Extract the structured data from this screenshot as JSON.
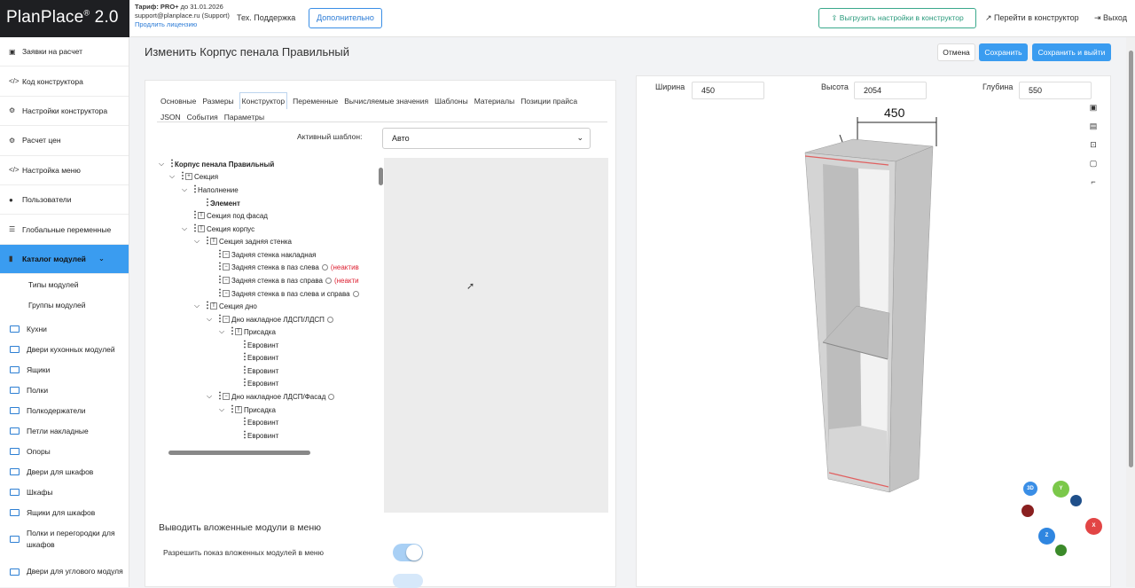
{
  "header": {
    "logo": "PlanPlace",
    "logo_sup": "®",
    "logo_suffix": " 2.0",
    "tariff_label": "Тариф: PRO+",
    "tariff_until": " до 31.01.2026",
    "email": "support@planplace.ru (Support)",
    "extend_license": "Продлить лицензию",
    "support": "Тех. Поддержка",
    "extra_button": "Дополнительно",
    "export_button": "Выгрузить настройки в конструктор",
    "go_constructor": "Перейти в конструктор",
    "logout": "Выход"
  },
  "sidebar": {
    "items": [
      {
        "label": "Заявки на расчет",
        "icon": "document-icon"
      },
      {
        "label": "Код конструктора",
        "icon": "code-icon"
      },
      {
        "label": "Настройки конструктора",
        "icon": "settings-icon"
      },
      {
        "label": "Расчет цен",
        "icon": "settings-icon"
      },
      {
        "label": "Настройка меню",
        "icon": "code-icon"
      },
      {
        "label": "Пользователи",
        "icon": "user-icon"
      },
      {
        "label": "Глобальные переменные",
        "icon": "list-icon"
      },
      {
        "label": "Каталог модулей",
        "icon": "book-icon"
      }
    ],
    "subitems": [
      "Типы модулей",
      "Группы модулей"
    ],
    "folders": [
      "Кухни",
      "Двери кухонных модулей",
      "Ящики",
      "Полки",
      "Полкодержатели",
      "Петли накладные",
      "Опоры",
      "Двери для шкафов",
      "Шкафы",
      "Ящики для шкафов",
      "Полки и перегородки для шкафов",
      "Двери для углового модуля"
    ]
  },
  "page": {
    "title": "Изменить Корпус пенала Правильный",
    "cancel": "Отмена",
    "save": "Сохранить",
    "save_exit": "Сохранить и выйти"
  },
  "tabs": [
    "Основные",
    "Размеры",
    "Конструктор",
    "Переменные",
    "Вычисляемые значения",
    "Шаблоны",
    "Материалы",
    "Позиции прайса",
    "JSON",
    "События",
    "Параметры"
  ],
  "active_tab": "Конструктор",
  "template": {
    "label": "Активный шаблон:",
    "value": "Авто"
  },
  "tree": [
    {
      "label": "Корпус пенала Правильный",
      "bold": true
    },
    {
      "label": "Секция"
    },
    {
      "label": "Наполнение"
    },
    {
      "label": "Элемент",
      "bold": true
    },
    {
      "label": "Секция под фасад"
    },
    {
      "label": "Секция корпус"
    },
    {
      "label": "Секция задняя стенка"
    },
    {
      "label": "Задняя стенка накладная"
    },
    {
      "label": "Задняя стенка в паз слева",
      "note": "(неактив"
    },
    {
      "label": "Задняя стенка в паз справа",
      "note": "(неакти"
    },
    {
      "label": "Задняя стенка в паз слева и справа"
    },
    {
      "label": "Секция дно"
    },
    {
      "label": "Дно накладное ЛДСП/ЛДСП"
    },
    {
      "label": "Присадка"
    },
    {
      "label": "Евровинт"
    },
    {
      "label": "Евровинт"
    },
    {
      "label": "Евровинт"
    },
    {
      "label": "Евровинт"
    },
    {
      "label": "Дно накладное ЛДСП/Фасад"
    },
    {
      "label": "Присадка"
    },
    {
      "label": "Евровинт"
    },
    {
      "label": "Евровинт"
    }
  ],
  "nested": {
    "title": "Выводить вложенные модули в меню",
    "label": "Разрешить показ вложенных модулей в меню",
    "enabled": true
  },
  "dimensions": {
    "width_label": "Ширина",
    "width": "450",
    "height_label": "Высота",
    "height": "2054",
    "depth_label": "Глубина",
    "depth": "550",
    "annotation": "450"
  },
  "gizmo": {
    "label_3d": "3D",
    "y": "Y",
    "x": "X",
    "z": "Z"
  },
  "colors": {
    "accent": "#3a9cf0",
    "export_green": "#2a9a7c",
    "warning_red": "#d23"
  }
}
